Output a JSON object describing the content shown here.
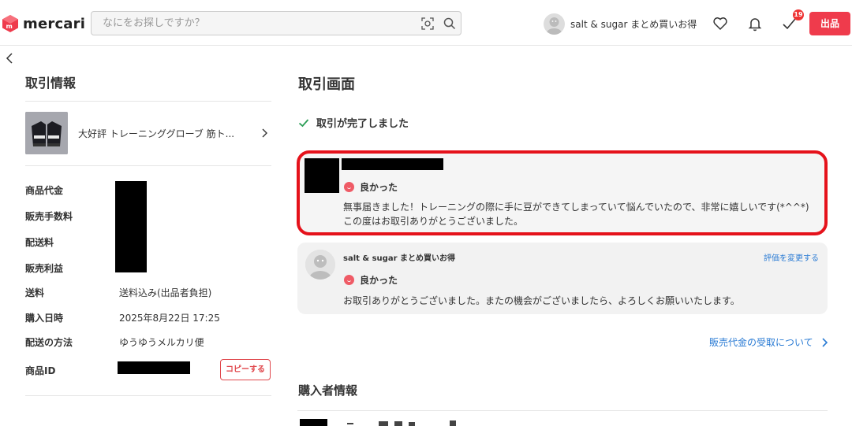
{
  "header": {
    "logo_text": "mercari",
    "search_placeholder": "なにをお探しですか？",
    "user_name": "salt & sugar まとめ買いお得",
    "todo_badge": "19",
    "sell_label": "出品"
  },
  "transaction_info": {
    "title": "取引情報",
    "product_name": "大好評 トレーニンググローブ 筋ト...",
    "rows": [
      {
        "label": "商品代金",
        "value": ""
      },
      {
        "label": "販売手数料",
        "value": ""
      },
      {
        "label": "配送料",
        "value": ""
      },
      {
        "label": "販売利益",
        "value": ""
      },
      {
        "label": "送料",
        "value": "送料込み(出品者負担)"
      },
      {
        "label": "購入日時",
        "value": "2025年8月22日 17:25"
      },
      {
        "label": "配送の方法",
        "value": "ゆうゆうメルカリ便"
      },
      {
        "label": "商品ID",
        "value": ""
      }
    ],
    "copy_label": "コピーする"
  },
  "transaction_screen": {
    "title": "取引画面",
    "status": "取引が完了しました",
    "buyer_review": {
      "rating": "良かった",
      "message": "無事届きました！トレーニングの際に手に豆ができてしまっていて悩んでいたので、非常に嬉しいです(*^^*) この度はお取引ありがとうございました。"
    },
    "seller_review": {
      "name": "salt & sugar まとめ買いお得",
      "change_link": "評価を変更する",
      "rating": "良かった",
      "message": "お取引ありがとうございました。またの機会がございましたら、よろしくお願いいたします。"
    },
    "payout_link": "販売代金の受取について",
    "buyer_info_title": "購入者情報"
  },
  "colors": {
    "brand_red": "#ef3b4c",
    "highlight_red": "#e5121b",
    "link_blue": "#2a7bd4"
  }
}
